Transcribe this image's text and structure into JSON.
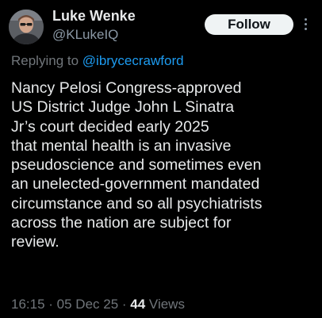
{
  "author": {
    "name": "Luke Wenke",
    "handle": "@KLukeIQ"
  },
  "follow_button": {
    "label": "Follow"
  },
  "more_menu": {
    "icon": "more-vertical-icon"
  },
  "reply": {
    "prefix": "Replying to ",
    "mention": "@ibrycecrawford"
  },
  "tweet": {
    "lines": [
      "Nancy Pelosi Congress-approved",
      "US District Judge John L Sinatra",
      "Jr’s court decided early 2025",
      "that mental health is an invasive",
      "pseudoscience and sometimes even",
      "an unelected-government mandated",
      "circumstance and so all psychiatrists",
      "across the nation are subject for",
      "review."
    ]
  },
  "meta": {
    "time": "16:15",
    "separator": " · ",
    "date": "05 Dec 25",
    "views_count": "44",
    "views_label": "Views"
  },
  "colors": {
    "background": "#000000",
    "text_primary": "#e7e9ea",
    "text_secondary": "#71767b",
    "accent": "#1d9bf0",
    "button_bg": "#eff3f4"
  }
}
